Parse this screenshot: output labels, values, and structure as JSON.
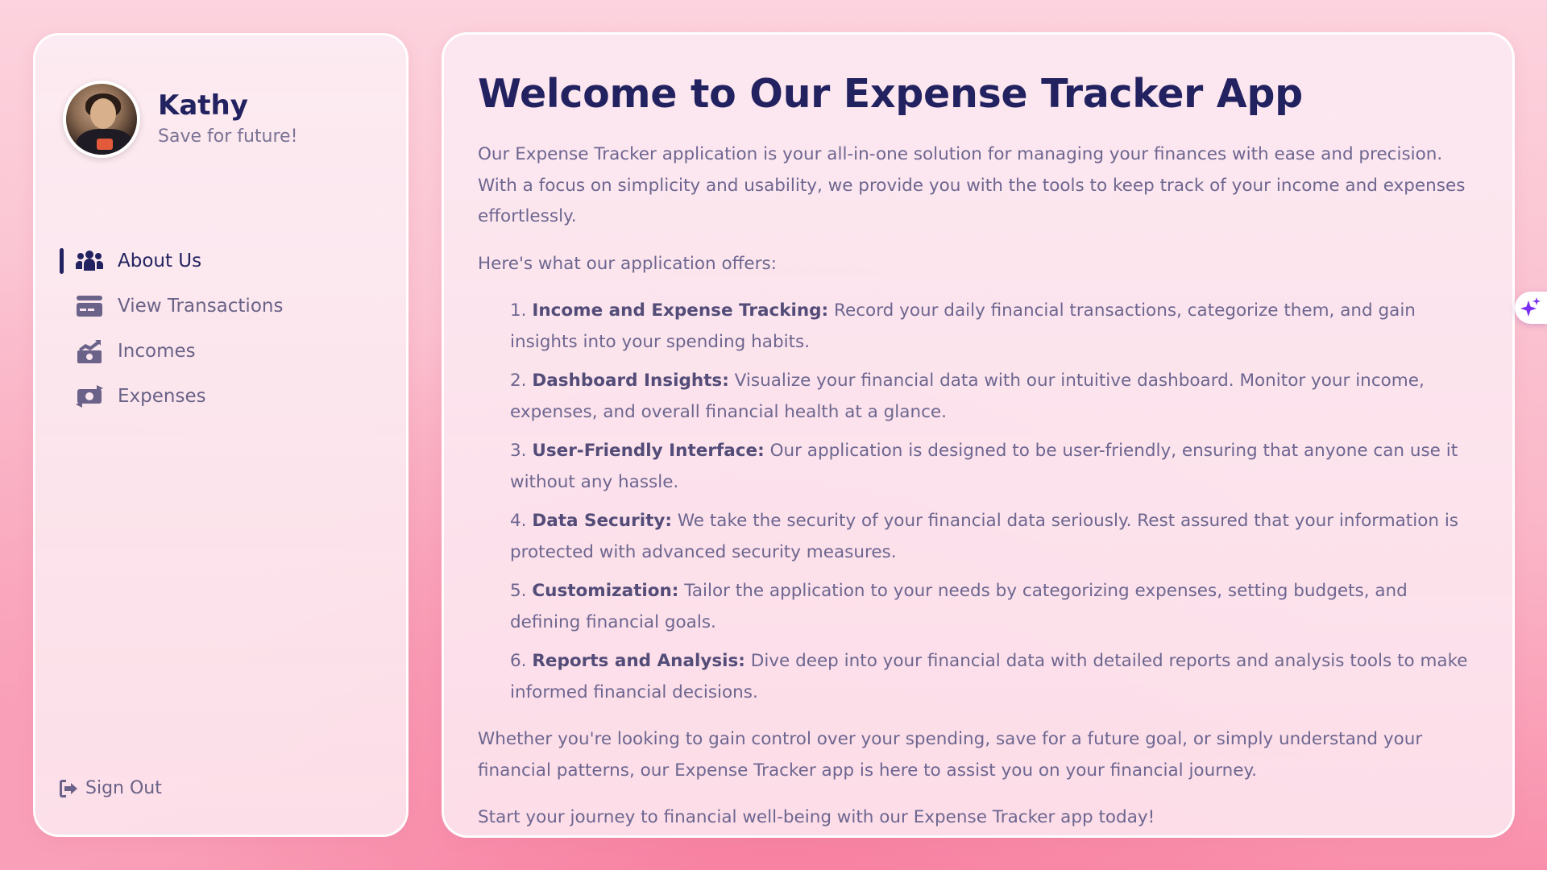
{
  "profile": {
    "name": "Kathy",
    "tagline": "Save for future!"
  },
  "nav": {
    "items": [
      {
        "label": "About Us",
        "icon": "users-icon",
        "active": true
      },
      {
        "label": "View Transactions",
        "icon": "credit-card-icon",
        "active": false
      },
      {
        "label": "Incomes",
        "icon": "money-bill-trend-up-icon",
        "active": false
      },
      {
        "label": "Expenses",
        "icon": "money-bill-transfer-icon",
        "active": false
      }
    ],
    "signout_label": "Sign Out"
  },
  "main": {
    "title": "Welcome to Our Expense Tracker App",
    "intro": "Our Expense Tracker application is your all-in-one solution for managing your finances with ease and precision. With a focus on simplicity and usability, we provide you with the tools to keep track of your income and expenses effortlessly.",
    "offers_heading": "Here's what our application offers:",
    "features": [
      {
        "number": "1.",
        "title": "Income and Expense Tracking:",
        "text": "Record your daily financial transactions, categorize them, and gain insights into your spending habits."
      },
      {
        "number": "2.",
        "title": "Dashboard Insights:",
        "text": "Visualize your financial data with our intuitive dashboard. Monitor your income, expenses, and overall financial health at a glance."
      },
      {
        "number": "3.",
        "title": "User-Friendly Interface:",
        "text": "Our application is designed to be user-friendly, ensuring that anyone can use it without any hassle."
      },
      {
        "number": "4.",
        "title": "Data Security:",
        "text": "We take the security of your financial data seriously. Rest assured that your information is protected with advanced security measures."
      },
      {
        "number": "5.",
        "title": "Customization:",
        "text": "Tailor the application to your needs by categorizing expenses, setting budgets, and defining financial goals."
      },
      {
        "number": "6.",
        "title": "Reports and Analysis:",
        "text": "Dive deep into your financial data with detailed reports and analysis tools to make informed financial decisions."
      }
    ],
    "closing": "Whether you're looking to gain control over your spending, save for a future goal, or simply understand your financial patterns, our Expense Tracker app is here to assist you on your financial journey.",
    "cta": "Start your journey to financial well-being with our Expense Tracker app today!"
  },
  "assistant": {
    "icon": "sparkles-icon",
    "color": "#7b2ff2"
  },
  "colors": {
    "heading": "#222260",
    "body_text": "#6d6690",
    "background_pink": "#fab7c8"
  }
}
